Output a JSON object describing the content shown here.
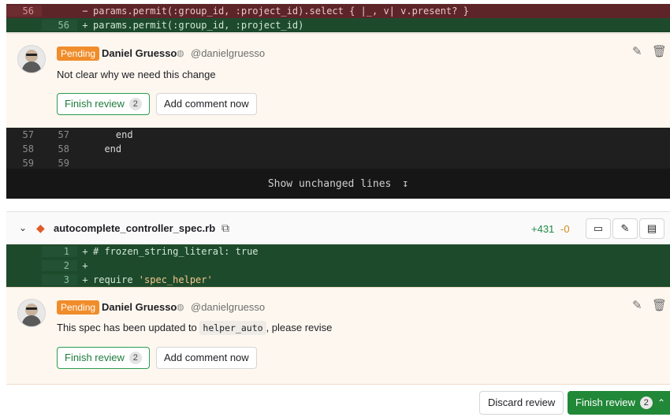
{
  "top_diff": {
    "removed_line": {
      "old": "56",
      "new": "",
      "sign": "−",
      "code": "params.permit(:group_id, :project_id).select { |_, v| v.present? }"
    },
    "added_line": {
      "old": "",
      "new": "56",
      "sign": "+",
      "code": "params.permit(:group_id, :project_id)"
    }
  },
  "comment1": {
    "badge": "Pending",
    "author": "Daniel Gruesso",
    "handle": "@danielgruesso",
    "text": "Not clear why we need this change",
    "finish_label": "Finish review",
    "finish_count": "2",
    "add_now_label": "Add comment now"
  },
  "context_lines": [
    {
      "old": "57",
      "new": "57",
      "code": "    end"
    },
    {
      "old": "58",
      "new": "58",
      "code": "  end"
    },
    {
      "old": "59",
      "new": "59",
      "code": ""
    }
  ],
  "show_unchanged": {
    "label": "Show unchanged lines",
    "icon": "expand-down-icon"
  },
  "file": {
    "name": "autocomplete_controller_spec.rb",
    "additions": "+431",
    "deletions": "-0",
    "icons": [
      "chevron-down-icon",
      "ruby-icon",
      "copy-icon",
      "comment-icon",
      "pencil-icon",
      "file-icon"
    ]
  },
  "file_lines": [
    {
      "new": "1",
      "sign": "+",
      "code": "# frozen_string_literal: true"
    },
    {
      "new": "2",
      "sign": "+",
      "code": ""
    },
    {
      "new": "3",
      "sign": "+",
      "code_pre": "require ",
      "code_str": "'spec_helper'"
    }
  ],
  "comment2": {
    "badge": "Pending",
    "author": "Daniel Gruesso",
    "handle": "@danielgruesso",
    "text_pre": "This spec has been updated to ",
    "text_code": "helper_auto",
    "text_post": ", please revise",
    "finish_label": "Finish review",
    "finish_count": "2",
    "add_now_label": "Add comment now"
  },
  "bottom": {
    "discard_label": "Discard review",
    "finish_label": "Finish review",
    "finish_count": "2"
  },
  "colors": {
    "pending": "#f08c2a",
    "added_bg": "#1e4a2c",
    "removed_bg": "#5e2528",
    "finish_green": "#218838"
  }
}
